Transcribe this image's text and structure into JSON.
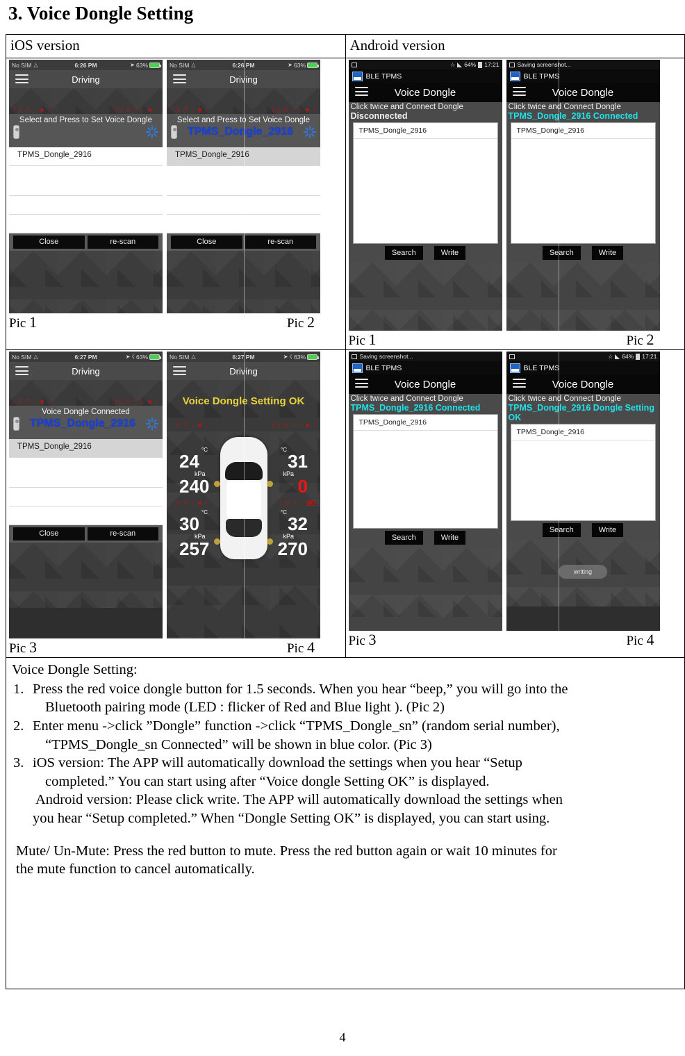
{
  "document": {
    "title": "3. Voice Dongle Setting",
    "page_number": "4"
  },
  "table": {
    "headers": {
      "ios": "iOS version",
      "android": "Android version"
    },
    "captions": {
      "pic1": "Pic",
      "pic1_n": "1",
      "pic2": "Pic",
      "pic2_n": "2",
      "pic3": "Pic",
      "pic3_n": "3",
      "pic4": "Pic",
      "pic4_n": "4"
    }
  },
  "ios_pic1": {
    "status": {
      "carrier": "No SIM",
      "time": "6:26 PM",
      "battery": "63%"
    },
    "nav_title": "Driving",
    "banner_text": "Select and Press to Set Voice Dongle",
    "banner_device": "",
    "list": [
      "TPMS_Dongle_2916"
    ],
    "buttons": {
      "close": "Close",
      "rescan": "re-scan"
    },
    "warn_left": "! 0 ? ↓ ■ !",
    "warn_right": "(!) 0 ? ↓ ■ !"
  },
  "ios_pic2": {
    "status": {
      "carrier": "No SIM",
      "time": "6:26 PM",
      "battery": "63%"
    },
    "nav_title": "Driving",
    "banner_text": "Select and Press to Set Voice Dongle",
    "banner_device": "TPMS_Dongle_2916",
    "list": [
      "TPMS_Dongle_2916"
    ],
    "buttons": {
      "close": "Close",
      "rescan": "re-scan"
    }
  },
  "ios_pic3": {
    "status": {
      "carrier": "No SIM",
      "time": "6:27 PM",
      "battery": "63%"
    },
    "nav_title": "Driving",
    "banner_text": "Voice Dongle Connected",
    "banner_device": "TPMS_Dongle_2916",
    "list": [
      "TPMS_Dongle_2916"
    ],
    "buttons": {
      "close": "Close",
      "rescan": "re-scan"
    }
  },
  "ios_pic4": {
    "status": {
      "carrier": "No SIM",
      "time": "6:27 PM",
      "battery": "63%"
    },
    "nav_title": "Driving",
    "ok_message": "Voice Dongle Setting OK",
    "tires": {
      "front_left": {
        "temp": "24",
        "temp_unit": "°C",
        "pressure": "240",
        "pressure_unit": "kPa",
        "alert": false
      },
      "front_right": {
        "temp": "31",
        "temp_unit": "°C",
        "pressure": "0",
        "pressure_unit": "kPa",
        "alert": true
      },
      "rear_left": {
        "temp": "30",
        "temp_unit": "°C",
        "pressure": "257",
        "pressure_unit": "kPa",
        "alert": false
      },
      "rear_right": {
        "temp": "32",
        "temp_unit": "°C",
        "pressure": "270",
        "pressure_unit": "kPa",
        "alert": false
      }
    }
  },
  "android_pic1": {
    "status": {
      "battery": "64%",
      "time": "17:21",
      "notice": ""
    },
    "app_name": "BLE TPMS",
    "nav_title": "Voice Dongle",
    "hint": "Click twice and Connect Dongle",
    "state": "Disconnected",
    "state_color": "#efefef",
    "list": [
      "TPMS_Dongle_2916"
    ],
    "buttons": {
      "search": "Search",
      "write": "Write"
    }
  },
  "android_pic2": {
    "status": {
      "notice": "Saving screenshot...",
      "battery": "",
      "time": ""
    },
    "app_name": "BLE TPMS",
    "nav_title": "Voice Dongle",
    "hint": "Click twice and Connect Dongle",
    "state": "TPMS_Dongle_2916 Connected",
    "state_color": "#21e0e8",
    "list": [
      "TPMS_Dongle_2916"
    ],
    "buttons": {
      "search": "Search",
      "write": "Write"
    }
  },
  "android_pic3": {
    "status": {
      "notice": "Saving screenshot...",
      "battery": "",
      "time": ""
    },
    "app_name": "BLE TPMS",
    "nav_title": "Voice Dongle",
    "hint": "Click twice and Connect Dongle",
    "state": "TPMS_Dongle_2916 Connected",
    "state_color": "#21e0e8",
    "list": [
      "TPMS_Dongle_2916"
    ],
    "buttons": {
      "search": "Search",
      "write": "Write"
    }
  },
  "android_pic4": {
    "status": {
      "battery": "64%",
      "time": "17:21",
      "notice": ""
    },
    "app_name": "BLE TPMS",
    "nav_title": "Voice Dongle",
    "hint": "Click twice and Connect Dongle",
    "state": "TPMS_Dongle_2916 Dongle Setting OK",
    "state_color": "#21e0e8",
    "list": [
      "TPMS_Dongle_2916"
    ],
    "buttons": {
      "search": "Search",
      "write": "Write"
    },
    "toast": "writing"
  },
  "instructions": {
    "heading": "Voice Dongle Setting:",
    "item1_num": "1.",
    "item1_line1": "Press the red voice dongle button for 1.5 seconds. When you hear “beep,” you will go into the",
    "item1_line2": "Bluetooth pairing mode (LED : flicker of Red and Blue light ). (Pic 2)",
    "item2_num": "2.",
    "item2_line1": "Enter menu ->click  ”Dongle” function ->click “TPMS_Dongle_sn” (random serial number),",
    "item2_line2": "“TPMS_Dongle_sn Connected” will be shown in blue color. (Pic 3)",
    "item3_num": "3.",
    "item3_line1": "iOS version: The APP will automatically download the settings when you hear “Setup",
    "item3_line2": "completed.” You can start using after “Voice dongle Setting OK” is displayed.",
    "item3_line3": "Android version: Please click write. The APP will automatically download the settings when",
    "item3_line4": "you hear “Setup completed.” When “Dongle Setting OK” is displayed, you can start using.",
    "mute_line1": "Mute/ Un-Mute: Press the red button to mute. Press the red button again or wait 10 minutes for",
    "mute_line2": "the mute function to cancel automatically."
  }
}
